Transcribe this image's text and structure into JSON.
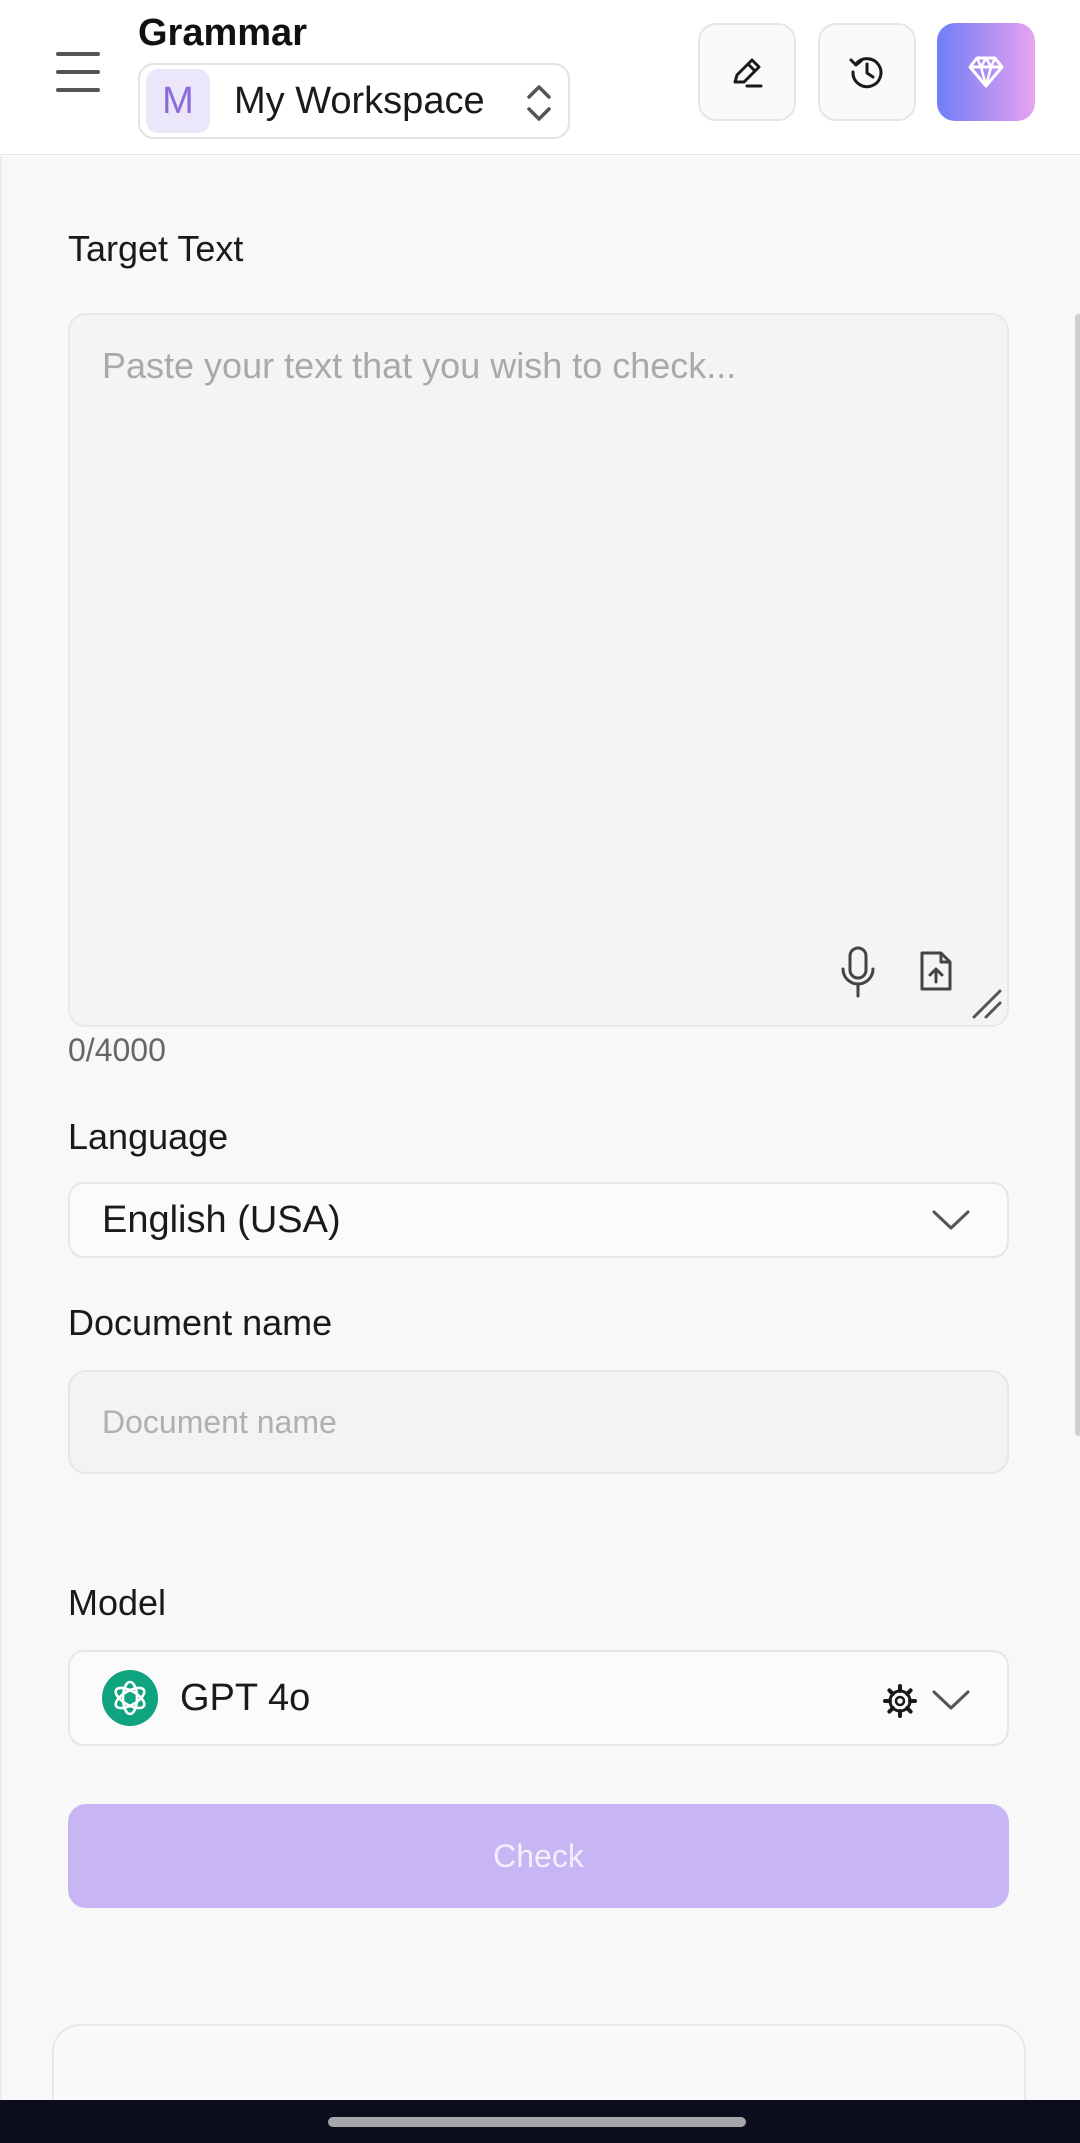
{
  "header": {
    "title": "Grammar",
    "workspace": {
      "initial": "M",
      "name": "My Workspace"
    }
  },
  "form": {
    "target": {
      "label": "Target Text",
      "placeholder": "Paste your text that you wish to check...",
      "counter": "0/4000"
    },
    "language": {
      "label": "Language",
      "value": "English (USA)"
    },
    "document": {
      "label": "Document name",
      "placeholder": "Document name"
    },
    "model": {
      "label": "Model",
      "value": "GPT 4o"
    },
    "check_label": "Check"
  },
  "colors": {
    "accent": "#c7b6f3",
    "workspace_avatar_bg": "#ece6fb",
    "model_logo": "#10a37f",
    "premium_gradient_start": "#6f7ef5",
    "premium_gradient_end": "#e7a5f0"
  },
  "icons": {
    "menu": "hamburger-menu-icon",
    "workspace_switch": "chevron-up-down-icon",
    "edit": "pen-edit-icon",
    "history": "history-icon",
    "premium": "diamond-icon",
    "mic": "microphone-icon",
    "upload": "file-upload-icon",
    "resize": "resize-handle-icon",
    "chevron": "chevron-down-icon",
    "gear": "gear-icon",
    "model": "openai-logo-icon"
  }
}
